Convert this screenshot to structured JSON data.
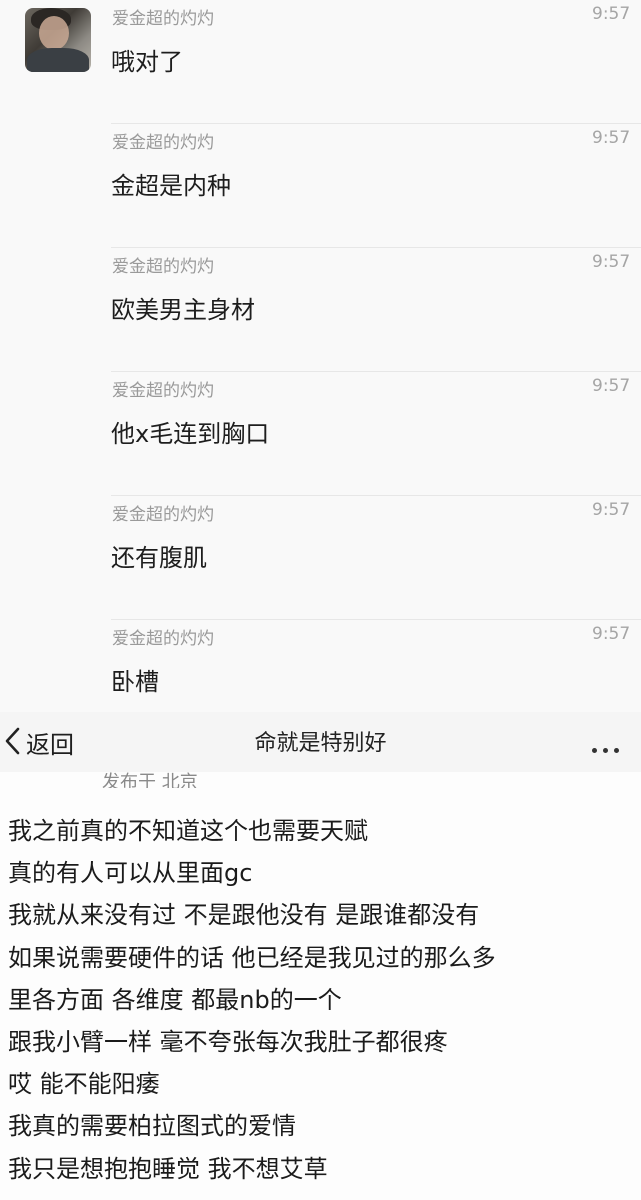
{
  "chat": {
    "messages": [
      {
        "sender": "爱金超的灼灼",
        "time": "9:57",
        "text": "哦对了"
      },
      {
        "sender": "爱金超的灼灼",
        "time": "9:57",
        "text": "金超是内种"
      },
      {
        "sender": "爱金超的灼灼",
        "time": "9:57",
        "text": "欧美男主身材"
      },
      {
        "sender": "爱金超的灼灼",
        "time": "9:57",
        "text": "他x毛连到胸口"
      },
      {
        "sender": "爱金超的灼灼",
        "time": "9:57",
        "text": "还有腹肌"
      },
      {
        "sender": "爱金超的灼灼",
        "time": "9:57",
        "text": "卧槽"
      }
    ]
  },
  "post": {
    "nav": {
      "back_label": "返回",
      "title": "命就是特别好",
      "more_icon": "more-horizontal-icon",
      "back_icon": "chevron-left-icon"
    },
    "location": "发布于 北京",
    "lines": [
      "我之前真的不知道这个也需要天赋",
      "真的有人可以从里面gc",
      "我就从来没有过 不是跟他没有 是跟谁都没有",
      "如果说需要硬件的话 他已经是我见过的那么多",
      "里各方面 各维度 都最nb的一个",
      "跟我小臂一样 毫不夸张每次我肚子都很疼",
      "哎 能不能阳痿",
      "我真的需要柏拉图式的爱情",
      "我只是想抱抱睡觉 我不想艾草"
    ]
  }
}
